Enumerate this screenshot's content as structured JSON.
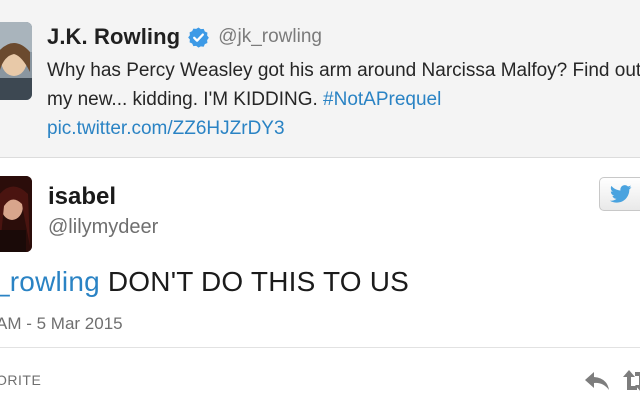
{
  "quoted_tweet": {
    "display_name": "J.K. Rowling",
    "verified_icon": "verified-badge-icon",
    "handle": "@jk_rowling",
    "text_line_1": "Why has Percy Weasley got his arm around Narcissa Malfoy? Find out in",
    "text_line_2_prefix": "my new... kidding. I'M KIDDING.",
    "hashtag": "#NotAPrequel",
    "pic_link": "pic.twitter.com/ZZ6HJZrDY3",
    "link_color": "#2a83c4"
  },
  "main_tweet": {
    "display_name": "isabel",
    "handle": "@lilymydeer",
    "follow_icon": "twitter-bird-icon",
    "mention": "_rowling",
    "body": " DON'T DO THIS TO US",
    "timestamp": "AM - 5 Mar 2015",
    "favorite_label": "ORITE",
    "reply_icon": "reply-icon",
    "retweet_icon": "retweet-icon"
  }
}
